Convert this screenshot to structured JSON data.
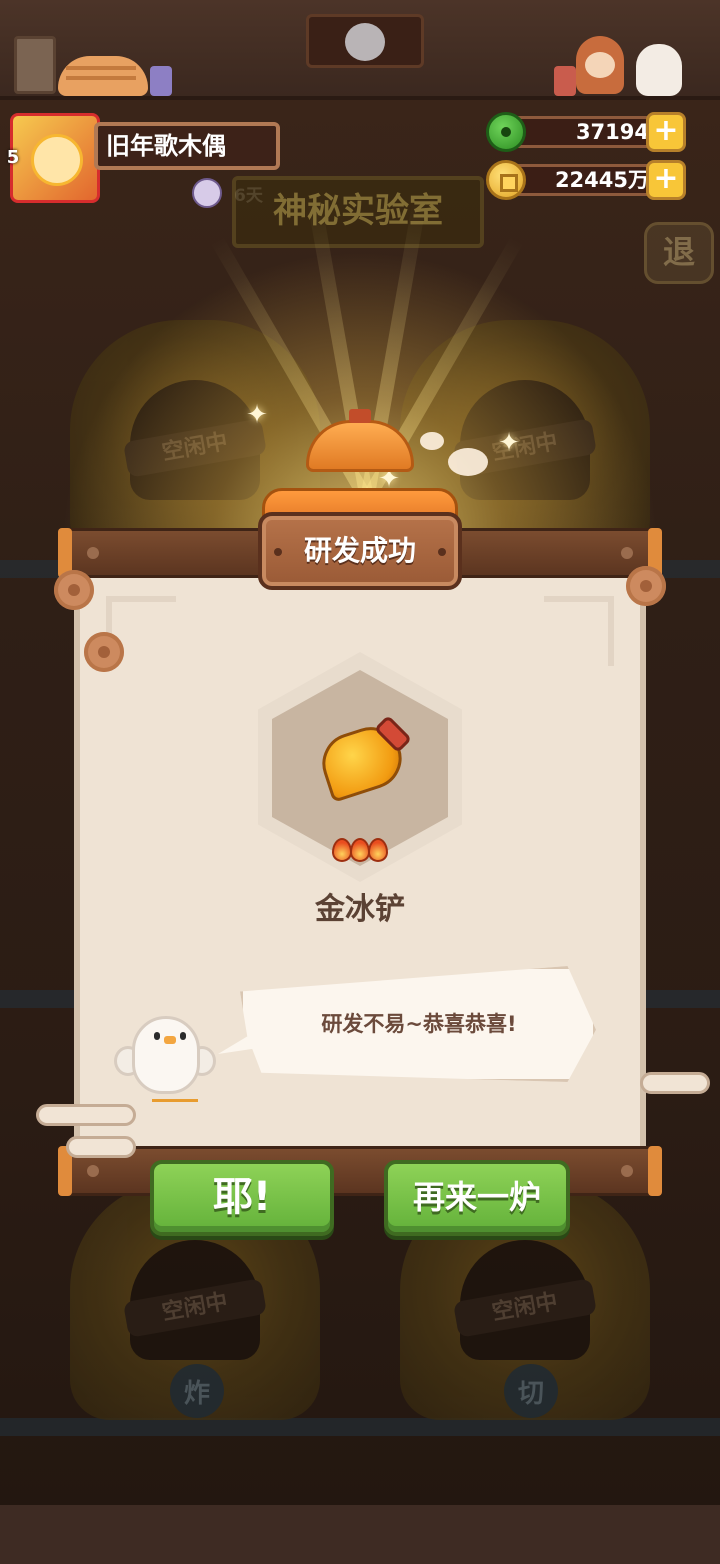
{
  "player": {
    "name": "旧年歌木偶",
    "level": "5",
    "vip_days": "6天"
  },
  "currency": {
    "jade": "37194",
    "gold": "22445万",
    "plus_label": "+"
  },
  "lab": {
    "title": "神秘实验室",
    "exit_label": "退",
    "idle_label": "空闲中",
    "badge_fry": "炸",
    "badge_cut": "切"
  },
  "result": {
    "title": "研发成功",
    "item_name": "金冰铲",
    "item_rank_fires": 3,
    "message": "研发不易~恭喜恭喜!"
  },
  "buttons": {
    "yay": "耶!",
    "again": "再来一炉"
  },
  "colors": {
    "accent_green": "#6fbf45",
    "plaque_brown": "#a8663f",
    "paper": "#efe3d4"
  }
}
